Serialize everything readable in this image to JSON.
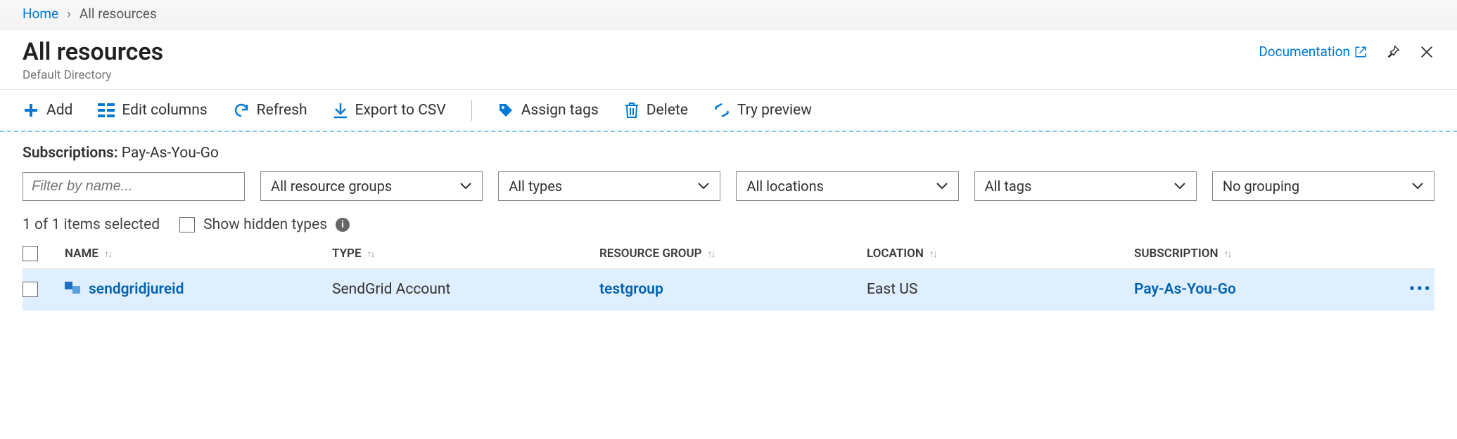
{
  "breadcrumb": {
    "home": "Home",
    "sep": "›",
    "current": "All resources"
  },
  "header": {
    "title": "All resources",
    "subtitle": "Default Directory",
    "documentation": "Documentation"
  },
  "toolbar": {
    "add": "Add",
    "edit_columns": "Edit columns",
    "refresh": "Refresh",
    "export_csv": "Export to CSV",
    "assign_tags": "Assign tags",
    "delete": "Delete",
    "try_preview": "Try preview"
  },
  "subscriptions": {
    "label": "Subscriptions:",
    "value": "Pay-As-You-Go"
  },
  "filters": {
    "name_placeholder": "Filter by name...",
    "resource_groups": "All resource groups",
    "types": "All types",
    "locations": "All locations",
    "tags": "All tags",
    "grouping": "No grouping"
  },
  "status": {
    "selection": "1 of 1 items selected",
    "show_hidden": "Show hidden types"
  },
  "table": {
    "headers": {
      "name": "NAME",
      "type": "TYPE",
      "resource_group": "RESOURCE GROUP",
      "location": "LOCATION",
      "subscription": "SUBSCRIPTION"
    },
    "rows": [
      {
        "name": "sendgridjureid",
        "type": "SendGrid Account",
        "resource_group": "testgroup",
        "location": "East US",
        "subscription": "Pay-As-You-Go"
      }
    ]
  }
}
